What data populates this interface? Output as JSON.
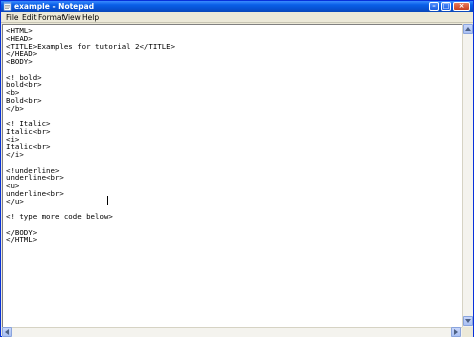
{
  "window": {
    "title": "example - Notepad",
    "controls": {
      "minimize": "–",
      "maximize": "□",
      "close": "×"
    }
  },
  "menu": {
    "items": [
      {
        "label": "File"
      },
      {
        "label": "Edit"
      },
      {
        "label": "Format"
      },
      {
        "label": "View"
      },
      {
        "label": "Help"
      }
    ]
  },
  "editor": {
    "lines": [
      "<HTML>",
      "<HEAD>",
      "<TITLE>Examples for tutorial 2</TITLE>",
      "</HEAD>",
      "<BODY>",
      "",
      "<! bold>",
      "bold<br>",
      "<b>",
      "Bold<br>",
      "</b>",
      "",
      "<! Italic>",
      "Italic<br>",
      "<i>",
      "Italic<br>",
      "</i>",
      "",
      "<!underline>",
      "underline<br>",
      "<u>",
      "underline<br>",
      "</u>",
      "",
      "<! type more code below>",
      "",
      "</BODY>",
      "</HTML>"
    ]
  },
  "icons": {
    "app": "notepad-icon",
    "scroll_up": "arrow-up-icon",
    "scroll_down": "arrow-down-icon",
    "scroll_left": "arrow-left-icon",
    "scroll_right": "arrow-right-icon"
  },
  "colors": {
    "titlebar": "#0a5fe8",
    "title_text": "#ffffff",
    "editor_bg": "#ffffff",
    "chrome": "#ece9d8"
  }
}
